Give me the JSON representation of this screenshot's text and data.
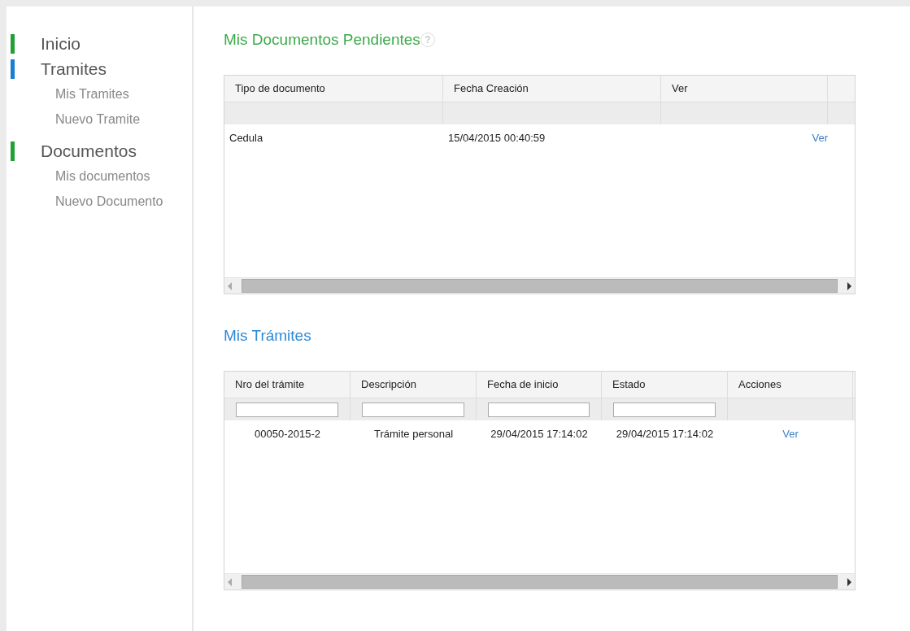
{
  "sidebar": {
    "items": [
      {
        "label": "Inicio",
        "color": "#22a038"
      },
      {
        "label": "Tramites",
        "color": "#1a7fd0",
        "children": [
          {
            "label": "Mis Tramites"
          },
          {
            "label": "Nuevo Tramite"
          }
        ]
      },
      {
        "label": "Documentos",
        "color": "#22a038",
        "children": [
          {
            "label": "Mis documentos"
          },
          {
            "label": "Nuevo Documento"
          }
        ]
      }
    ]
  },
  "sections": [
    {
      "title": "Mis Documentos Pendientes",
      "color": "#3daa4a",
      "help": "?",
      "table": {
        "columns": [
          {
            "label": "Tipo de documento",
            "filter": false
          },
          {
            "label": "Fecha Creación",
            "filter": false
          },
          {
            "label": "Ver",
            "filter": false
          }
        ],
        "rows": [
          [
            {
              "text": "Cedula",
              "kind": "text"
            },
            {
              "text": "15/04/2015 00:40:59",
              "kind": "text"
            },
            {
              "text": "Ver",
              "kind": "link"
            }
          ]
        ]
      }
    },
    {
      "title": "Mis Trámites",
      "color": "#2f8ad6",
      "table": {
        "columns": [
          {
            "label": "Nro del trámite",
            "filter": true
          },
          {
            "label": "Descripción",
            "filter": true
          },
          {
            "label": "Fecha de inicio",
            "filter": true
          },
          {
            "label": "Estado",
            "filter": true
          },
          {
            "label": "Acciones",
            "filter": false
          }
        ],
        "rows": [
          [
            {
              "text": "00050-2015-2",
              "kind": "text"
            },
            {
              "text": "Trámite personal",
              "kind": "text"
            },
            {
              "text": "29/04/2015 17:14:02",
              "kind": "text"
            },
            {
              "text": "29/04/2015 17:14:02",
              "kind": "text"
            },
            {
              "text": "Ver",
              "kind": "link"
            }
          ]
        ]
      }
    }
  ]
}
